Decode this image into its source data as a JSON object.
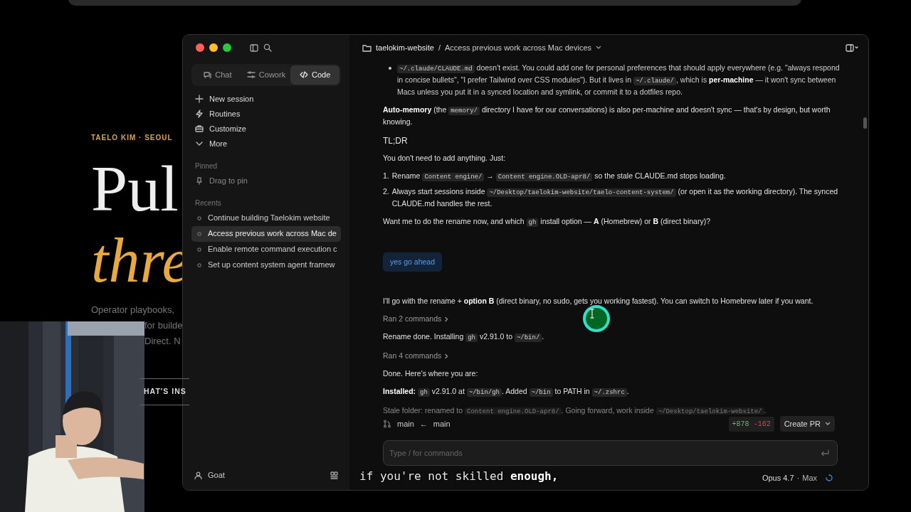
{
  "website": {
    "eyebrow": "TAELO KIM · SEOUL",
    "headline_1": "Pul",
    "headline_2": "thre",
    "lines": [
      "Operator playbooks,",
      "for builde",
      "Direct. N"
    ],
    "cta": "HAT'S INS"
  },
  "sidebar": {
    "mode_tabs": [
      {
        "label": "Chat",
        "selected": false
      },
      {
        "label": "Cowork",
        "selected": false
      },
      {
        "label": "Code",
        "selected": true
      }
    ],
    "nav": [
      {
        "label": "New session"
      },
      {
        "label": "Routines"
      },
      {
        "label": "Customize"
      },
      {
        "label": "More"
      }
    ],
    "pinned": {
      "heading": "Pinned",
      "hint": "Drag to pin"
    },
    "recents": {
      "heading": "Recents",
      "items": [
        {
          "label": "Continue building Taelokim website",
          "selected": false
        },
        {
          "label": "Access previous work across Mac de",
          "selected": true
        },
        {
          "label": "Enable remote command execution c",
          "selected": false
        },
        {
          "label": "Set up content system agent framew",
          "selected": false
        }
      ]
    },
    "user": {
      "name": "Goat"
    }
  },
  "header": {
    "project": "taelokim-website",
    "separator": "/",
    "title": "Access previous work across Mac devices"
  },
  "messages": [
    {
      "kind": "bullet",
      "parts": [
        {
          "kind": "code",
          "text": "~/.claude/CLAUDE.md"
        },
        {
          "kind": "text",
          "text": " doesn't exist. You could add one for personal preferences that should apply everywhere (e.g. \"always respond in concise bullets\", \"I prefer Tailwind over CSS modules\"). But it lives in "
        },
        {
          "kind": "code",
          "text": "~/.claude/"
        },
        {
          "kind": "text",
          "text": ", which is **per-machine** — it won't sync between Macs unless you put it in a synced location and symlink, or commit it to a dotfiles repo."
        }
      ]
    },
    {
      "kind": "paragraph",
      "parts": [
        {
          "kind": "text",
          "text": "**Auto-memory** (the "
        },
        {
          "kind": "code",
          "text": "memory/"
        },
        {
          "kind": "text",
          "text": " directory I have for our conversations) is also per-machine and doesn't sync — that's by design, but worth knowing."
        }
      ]
    },
    {
      "kind": "heading",
      "parts": [
        {
          "kind": "text",
          "text": "TL;DR"
        }
      ]
    },
    {
      "kind": "paragraph",
      "parts": [
        {
          "kind": "text",
          "text": "You don't need to add anything. Just:"
        }
      ]
    },
    {
      "kind": "numbered",
      "number": "1.",
      "parts": [
        {
          "kind": "text",
          "text": "Rename "
        },
        {
          "kind": "code",
          "text": "Content engine/"
        },
        {
          "kind": "text",
          "text": " → "
        },
        {
          "kind": "code",
          "text": "Content engine.OLD-apr8/"
        },
        {
          "kind": "text",
          "text": " so the stale CLAUDE.md stops loading."
        }
      ]
    },
    {
      "kind": "numbered",
      "number": "2.",
      "parts": [
        {
          "kind": "text",
          "text": "Always start sessions inside "
        },
        {
          "kind": "code",
          "text": "~/Desktop/taelokim-website/taelo-content-system/"
        },
        {
          "kind": "text",
          "text": " (or open it as the working directory). The synced CLAUDE.md handles the rest."
        }
      ]
    },
    {
      "kind": "paragraph",
      "parts": [
        {
          "kind": "text",
          "text": "Want me to do the rename now, and which "
        },
        {
          "kind": "code",
          "text": "gh"
        },
        {
          "kind": "text",
          "text": " install option — **A** (Homebrew) or **B** (direct binary)?"
        }
      ]
    },
    {
      "kind": "user",
      "parts": [
        {
          "kind": "text",
          "text": "yes go ahead"
        }
      ]
    },
    {
      "kind": "paragraph",
      "parts": [
        {
          "kind": "text",
          "text": "I'll go with the rename + **option B** (direct binary, no sudo, gets you working fastest). You can switch to Homebrew later if you want."
        }
      ]
    },
    {
      "kind": "tool",
      "parts": [
        {
          "kind": "text",
          "text": "Ran 2 commands"
        }
      ]
    },
    {
      "kind": "paragraph",
      "parts": [
        {
          "kind": "text",
          "text": "Rename done. Installing "
        },
        {
          "kind": "code",
          "text": "gh"
        },
        {
          "kind": "text",
          "text": " v2.91.0 to "
        },
        {
          "kind": "code",
          "text": "~/bin/"
        },
        {
          "kind": "text",
          "text": "."
        }
      ]
    },
    {
      "kind": "tool",
      "parts": [
        {
          "kind": "text",
          "text": "Ran 4 commands"
        }
      ]
    },
    {
      "kind": "paragraph",
      "parts": [
        {
          "kind": "text",
          "text": "Done. Here's where you are:"
        }
      ]
    },
    {
      "kind": "paragraph",
      "parts": [
        {
          "kind": "text",
          "text": "**Installed:** "
        },
        {
          "kind": "code",
          "text": "gh"
        },
        {
          "kind": "text",
          "text": " v2.91.0 at "
        },
        {
          "kind": "code",
          "text": "~/bin/gh"
        },
        {
          "kind": "text",
          "text": ". Added "
        },
        {
          "kind": "code",
          "text": "~/bin"
        },
        {
          "kind": "text",
          "text": " to PATH in "
        },
        {
          "kind": "code",
          "text": "~/.zshrc"
        },
        {
          "kind": "text",
          "text": "."
        }
      ]
    },
    {
      "kind": "paragraph",
      "parts": [
        {
          "kind": "text",
          "text": "Stale folder: renamed to "
        },
        {
          "kind": "code",
          "text": "Content engine.OLD-apr8/"
        },
        {
          "kind": "text",
          "text": ". Going forward, work inside "
        },
        {
          "kind": "code",
          "text": "~/Desktop/taelokim-website/"
        },
        {
          "kind": "text",
          "text": "."
        }
      ]
    }
  ],
  "branch_bar": {
    "source": "main",
    "arrow": "←",
    "target": "main",
    "added": "+878",
    "removed": "-162",
    "action": "Create PR"
  },
  "composer": {
    "placeholder": "Type / for commands"
  },
  "footer": {
    "model": "Opus 4.7",
    "separator": "·",
    "effort": "Max"
  },
  "caption": "if you're not skilled **enough,**"
}
